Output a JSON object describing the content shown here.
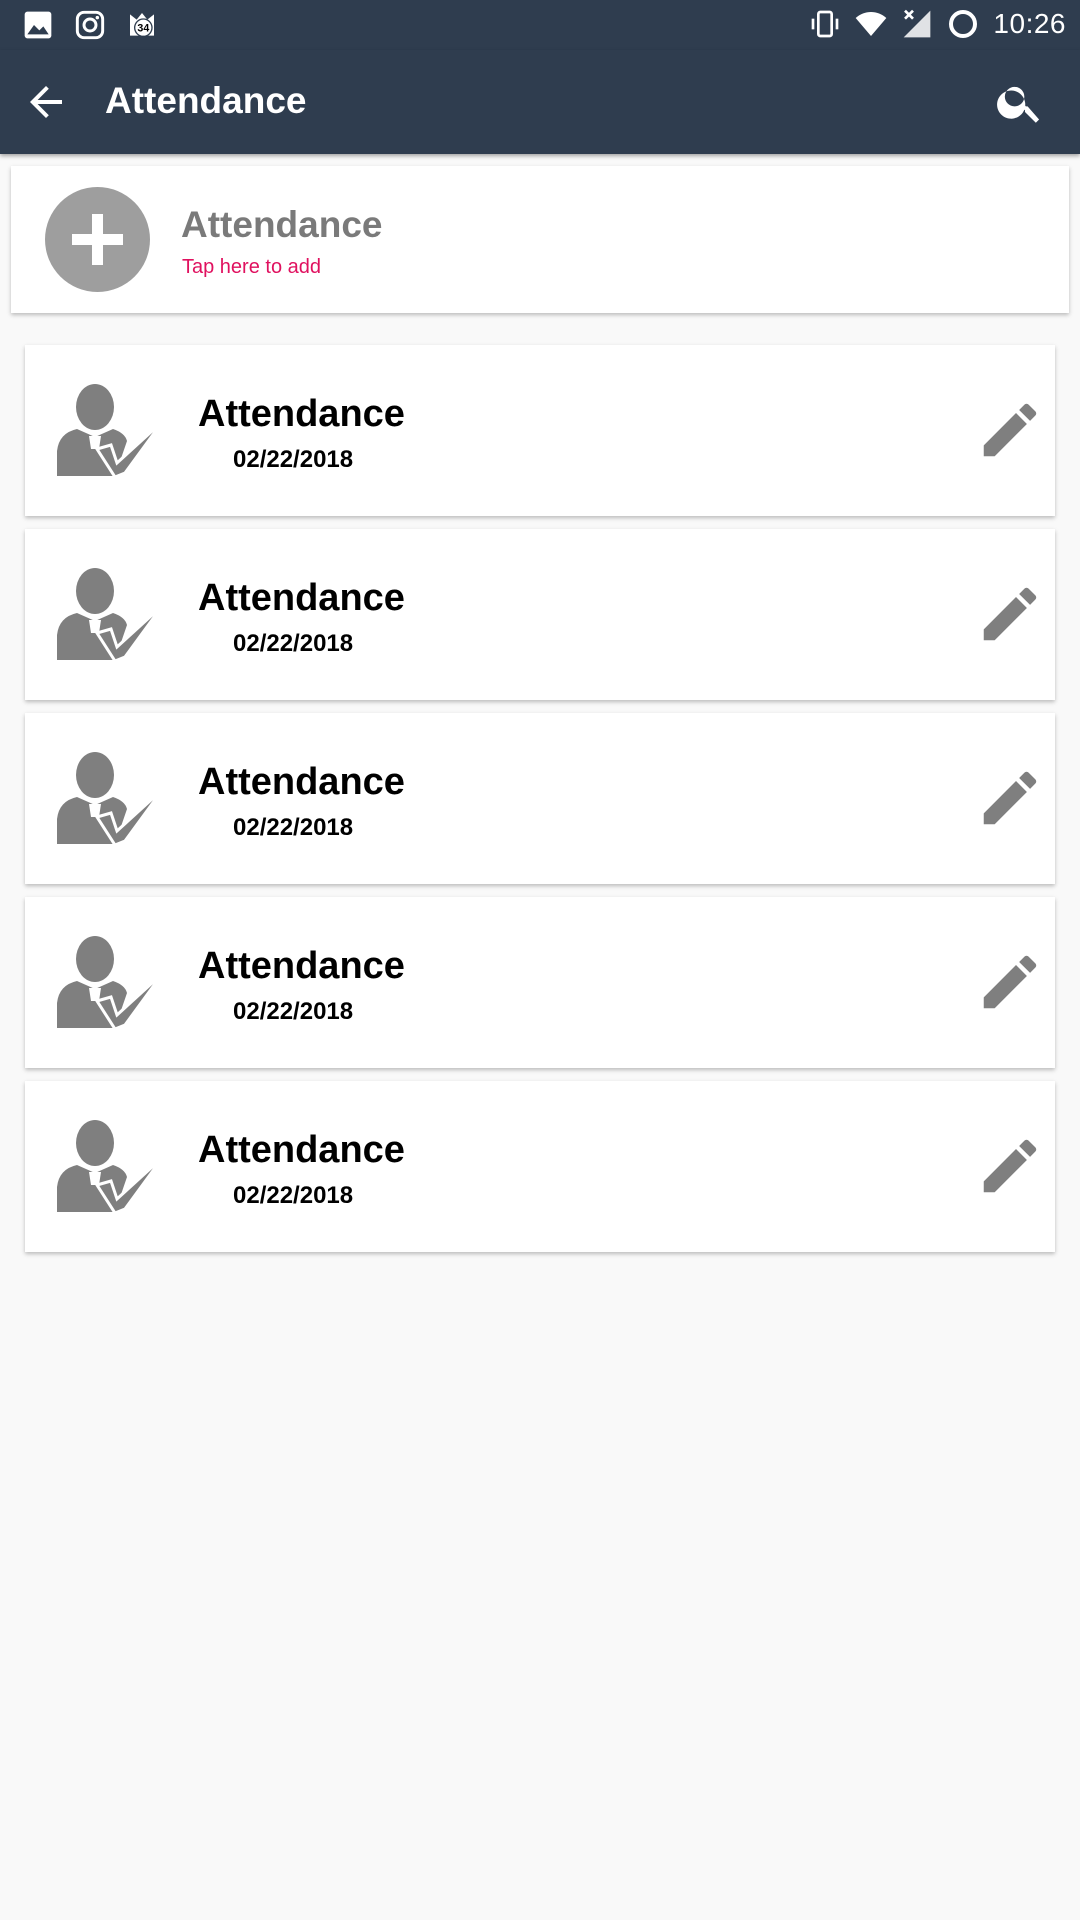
{
  "status_bar": {
    "time": "10:26",
    "notification_badge": "34",
    "icons": [
      "image-icon",
      "instagram-icon",
      "notification-34-icon",
      "vibrate-icon",
      "wifi-icon",
      "no-signal-icon",
      "battery-ring-icon"
    ]
  },
  "app_bar": {
    "title": "Attendance",
    "back_icon": "arrow-back-icon",
    "search_icon": "search-icon",
    "background_color": "#2f3d4f"
  },
  "add_card": {
    "title": "Attendance",
    "subtitle": "Tap here to add",
    "subtitle_color": "#e0115f",
    "icon": "plus-circle-icon"
  },
  "items": [
    {
      "title": "Attendance",
      "date": "02/22/2018"
    },
    {
      "title": "Attendance",
      "date": "02/22/2018"
    },
    {
      "title": "Attendance",
      "date": "02/22/2018"
    },
    {
      "title": "Attendance",
      "date": "02/22/2018"
    },
    {
      "title": "Attendance",
      "date": "02/22/2018"
    }
  ],
  "item_icons": {
    "leading": "person-check-icon",
    "trailing": "pencil-edit-icon"
  }
}
